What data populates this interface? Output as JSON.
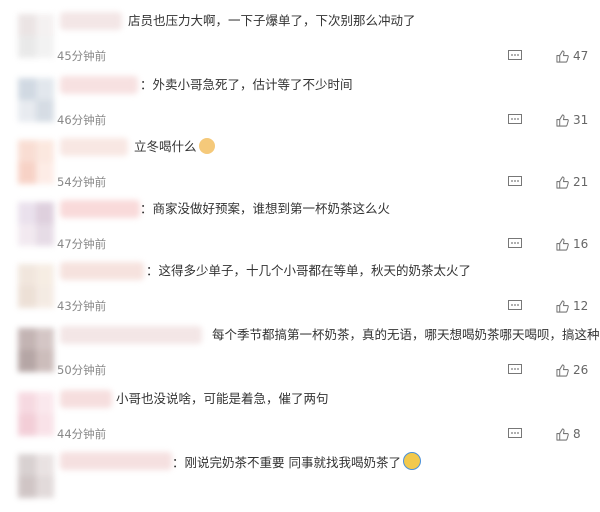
{
  "comments": [
    {
      "text": "店员也压力大啊，一下子爆单了，下次别那么冲动了",
      "time": "45分钟前",
      "likes": "47",
      "avatar_colors": [
        "#e8e0e0",
        "#f3efef",
        "#e6e6e6",
        "#f0f0f0"
      ],
      "name_color": "#f3e6e6"
    },
    {
      "text": "：外卖小哥急死了，估计等了不少时间",
      "time": "46分钟前",
      "likes": "31",
      "avatar_colors": [
        "#c9d3de",
        "#dde3ea",
        "#e4e8ee",
        "#cfd7e0"
      ],
      "name_color": "#f7e1e1"
    },
    {
      "text": "立冬喝什么",
      "time": "54分钟前",
      "likes": "21",
      "emoji": "cat-face",
      "avatar_colors": [
        "#f8d8cc",
        "#fbe4da",
        "#f6cbbd",
        "#fde9e2"
      ],
      "name_color": "#f8e7e3"
    },
    {
      "text": "：商家没做好预案，谁想到第一杯奶茶这么火",
      "time": "47分钟前",
      "likes": "16",
      "avatar_colors": [
        "#e7dcea",
        "#d9c8d8",
        "#f0e6ee",
        "#e2d6e2"
      ],
      "name_color": "#f9dada"
    },
    {
      "text": "：这得多少单子，十几个小哥都在等单，秋天的奶茶太火了",
      "time": "43分钟前",
      "likes": "12",
      "avatar_colors": [
        "#efe2d8",
        "#f5eadf",
        "#eadbd0",
        "#f3e8df"
      ],
      "name_color": "#f6e2de"
    },
    {
      "text": "每个季节都搞第一杯奶茶，真的无语，哪天想喝奶茶哪天喝呗，搞这种噱头",
      "time": "50分钟前",
      "likes": "26",
      "avatar_colors": [
        "#b9a7a6",
        "#cdbdbc",
        "#a99796",
        "#c4b2b0"
      ],
      "name_color": "#f3e6e6"
    },
    {
      "text": "小哥也没说啥，可能是着急，催了两句",
      "time": "44分钟前",
      "likes": "8",
      "avatar_colors": [
        "#f5d3dc",
        "#fae4ea",
        "#f1c6d1",
        "#f8dde4"
      ],
      "name_color": "#f6dede"
    },
    {
      "text": "：刚说完奶茶不重要 同事就找我喝奶茶了",
      "time": "",
      "likes": "",
      "emoji": "laughing-face",
      "avatar_colors": [
        "#d2c9c9",
        "#e6dede",
        "#c8bcbc",
        "#ddd4d4"
      ],
      "name_color": "#f5e0e0"
    }
  ]
}
